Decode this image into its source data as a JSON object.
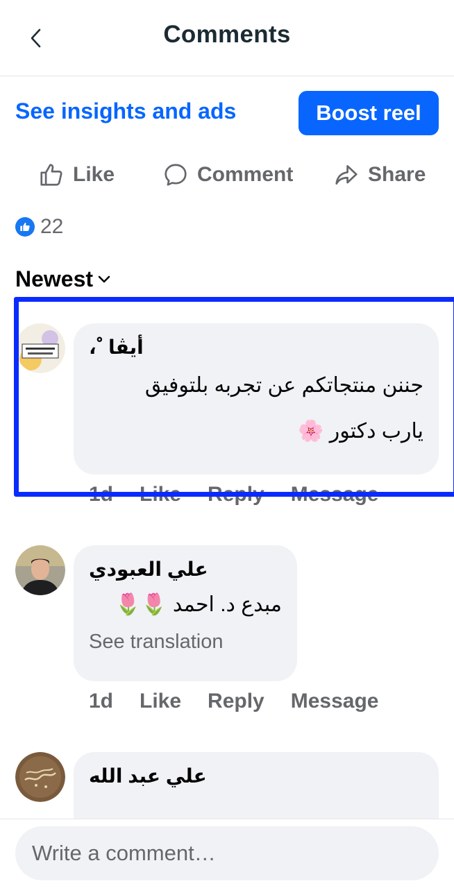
{
  "header": {
    "title": "Comments",
    "back_icon": "chevron-left-icon"
  },
  "top_actions": {
    "insights_label": "See insights and ads",
    "boost_label": "Boost reel"
  },
  "post_actions": [
    {
      "label": "Like",
      "icon": "thumbs-up-icon"
    },
    {
      "label": "Comment",
      "icon": "comment-bubble-icon"
    },
    {
      "label": "Share",
      "icon": "share-arrow-icon"
    }
  ],
  "reactions": {
    "count": "22",
    "icon": "like-badge-icon"
  },
  "sort": {
    "label": "Newest",
    "icon": "chevron-down-icon"
  },
  "comments": [
    {
      "author": "أيڤا ﹾ،",
      "lines": [
        "جننن منتجاتكم عن تجربه بلتوفيق",
        "يارب دكتور 🌸"
      ],
      "time": "1d",
      "like": "Like",
      "reply": "Reply",
      "message": "Message"
    },
    {
      "author": "علي العبودي",
      "lines": [
        "مبدع د. احمد 🌷🌷"
      ],
      "see_translation": "See translation",
      "time": "1d",
      "like": "Like",
      "reply": "Reply",
      "message": "Message"
    },
    {
      "author": "علي عبد الله"
    }
  ],
  "composer": {
    "placeholder": "Write a comment…"
  },
  "colors": {
    "accent": "#0866ff",
    "bubble": "#f0f2f5",
    "muted": "#65676b",
    "highlight": "#0a2bff"
  }
}
